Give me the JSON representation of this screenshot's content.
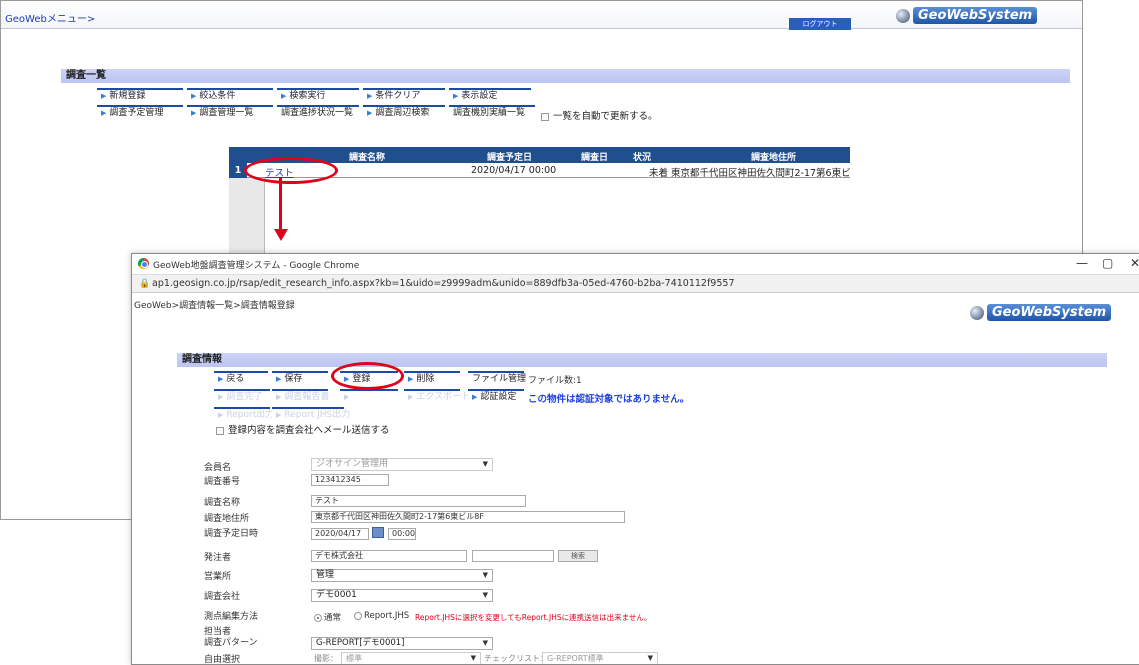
{
  "back": {
    "menu_link": "GeoWebメニュー>",
    "logout": "ログアウト",
    "logo": "GeoWebSystem",
    "section_title": "調査一覧",
    "toolbar_row1": [
      "新規登録",
      "絞込条件",
      "検索実行",
      "条件クリア",
      "表示設定"
    ],
    "toolbar_row2": [
      "調査予定管理",
      "調査管理一覧",
      "調査進捗状況一覧",
      "調査周辺検索",
      "調査機別実績一覧"
    ],
    "auto_refresh": "一覧を自動で更新する。",
    "table": {
      "headers": [
        "調査名称",
        "調査予定日",
        "調査日",
        "状況",
        "調査地住所"
      ],
      "rows": [
        {
          "num": "1",
          "name": "テスト",
          "planned": "2020/04/17 00:00",
          "date": "",
          "status": "未着",
          "address": "東京都千代田区神田佐久間町2-17第6東ビ"
        }
      ]
    }
  },
  "front": {
    "window_title": "GeoWeb地盤調査管理システム - Google Chrome",
    "window_controls": [
      "—",
      "▢",
      "✕"
    ],
    "url": "ap1.geosign.co.jp/rsap/edit_research_info.aspx?kb=1&uido=z9999adm&unido=889dfb3a-05ed-4760-b2ba-7410112f9557",
    "breadcrumb": "GeoWeb>調査情報一覧>調査情報登録",
    "logo": "GeoWebSystem",
    "section_title": "調査情報",
    "toolbar_row1": [
      "戻る",
      "保存",
      "登録",
      "削除",
      "ファイル管理"
    ],
    "file_count": "ファイル数:1",
    "toolbar_row2_dim": [
      "調査完了",
      "調査報告書",
      "",
      "エクスポート"
    ],
    "cert_button": "認証設定",
    "cert_notice": "この物件は認証対象ではありません。",
    "toolbar_row3_dim": [
      "Report出力",
      "Report JHS出力"
    ],
    "mail_check": "登録内容を調査会社へメール送信する",
    "form": {
      "member_label": "会員名",
      "member_value": "ジオサイン管理用",
      "number_label": "調査番号",
      "number_value": "123412345",
      "name_label": "調査名称",
      "name_value": "テスト",
      "address_label": "調査地住所",
      "address_value": "東京都千代田区神田佐久間町2-17第6東ビル8F",
      "date_label": "調査予定日時",
      "date_value": "2020/04/17",
      "time_value": "00:00",
      "client_label": "発注者",
      "client_value": "デモ株式会社",
      "search_btn": "検索",
      "office_label": "営業所",
      "office_value": "管理",
      "company_label": "調査会社",
      "company_value": "デモ0001",
      "method_label": "測点編集方法",
      "method_opt1": "通常",
      "method_opt2": "Report.JHS",
      "method_note": "Report.JHSに選択を変更してもReport.JHSに連携送信は出来ません。",
      "staff_label": "担当者",
      "pattern_label": "調査パターン",
      "pattern_value": "G-REPORT[デモ0001]",
      "free_label": "自由選択",
      "photo_label": "撮影：",
      "photo_value": "標準",
      "check_label": "チェックリスト：",
      "check_value": "G-REPORT標準"
    }
  },
  "colors": {
    "annotation": "#e3001b",
    "header": "#1f4f8f",
    "section": "#c4cbf4"
  }
}
